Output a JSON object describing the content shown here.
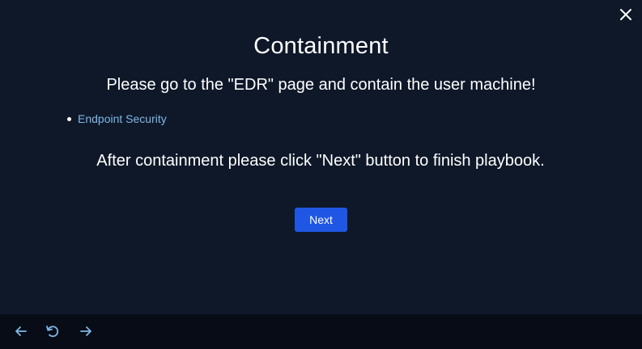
{
  "dialog": {
    "title": "Containment",
    "instruction": "Please go to the \"EDR\" page and contain the user machine!",
    "links": [
      {
        "label": "Endpoint Security"
      }
    ],
    "followup": "After containment please click \"Next\" button to finish playbook.",
    "next_label": "Next",
    "close_icon": "close-icon"
  },
  "colors": {
    "background": "#0f1829",
    "bottom_bar": "#070c16",
    "accent_button": "#1f56e3",
    "link": "#7fb8e6",
    "text": "#ffffff"
  },
  "bottom_nav": {
    "icons": [
      "arrow-left-icon",
      "reload-icon",
      "arrow-right-icon"
    ]
  }
}
